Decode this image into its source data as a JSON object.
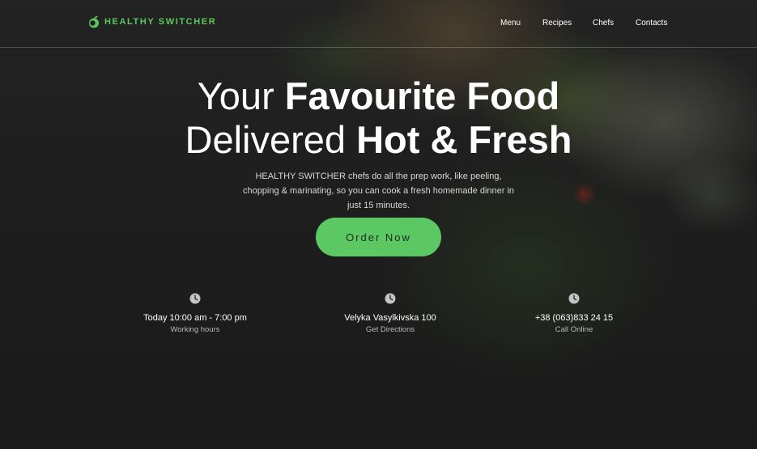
{
  "brand": {
    "name": "HEALTHY SWITCHER",
    "logo_icon": "apple-icon",
    "accent_color": "#5cc85c"
  },
  "nav": {
    "items": [
      "Menu",
      "Recipes",
      "Chefs",
      "Contacts"
    ]
  },
  "hero": {
    "headline_line1_light": "Your ",
    "headline_line1_bold": "Favourite Food",
    "headline_line2_light": "Delivered ",
    "headline_line2_bold": "Hot & Fresh",
    "description": "HEALTHY SWITCHER chefs do all the prep work, like peeling, chopping & marinating, so you can cook a fresh homemade dinner in just 15 minutes.",
    "cta_label": "Order Now",
    "cta_color": "#5cc864"
  },
  "info": [
    {
      "icon": "clock-icon",
      "title": "Today 10:00 am - 7:00 pm",
      "subtitle": "Working hours"
    },
    {
      "icon": "clock-icon",
      "title": "Velyka Vasylkivska 100",
      "subtitle": "Get Directions"
    },
    {
      "icon": "clock-icon",
      "title": "+38 (063)833 24 15",
      "subtitle": "Call Online"
    }
  ]
}
